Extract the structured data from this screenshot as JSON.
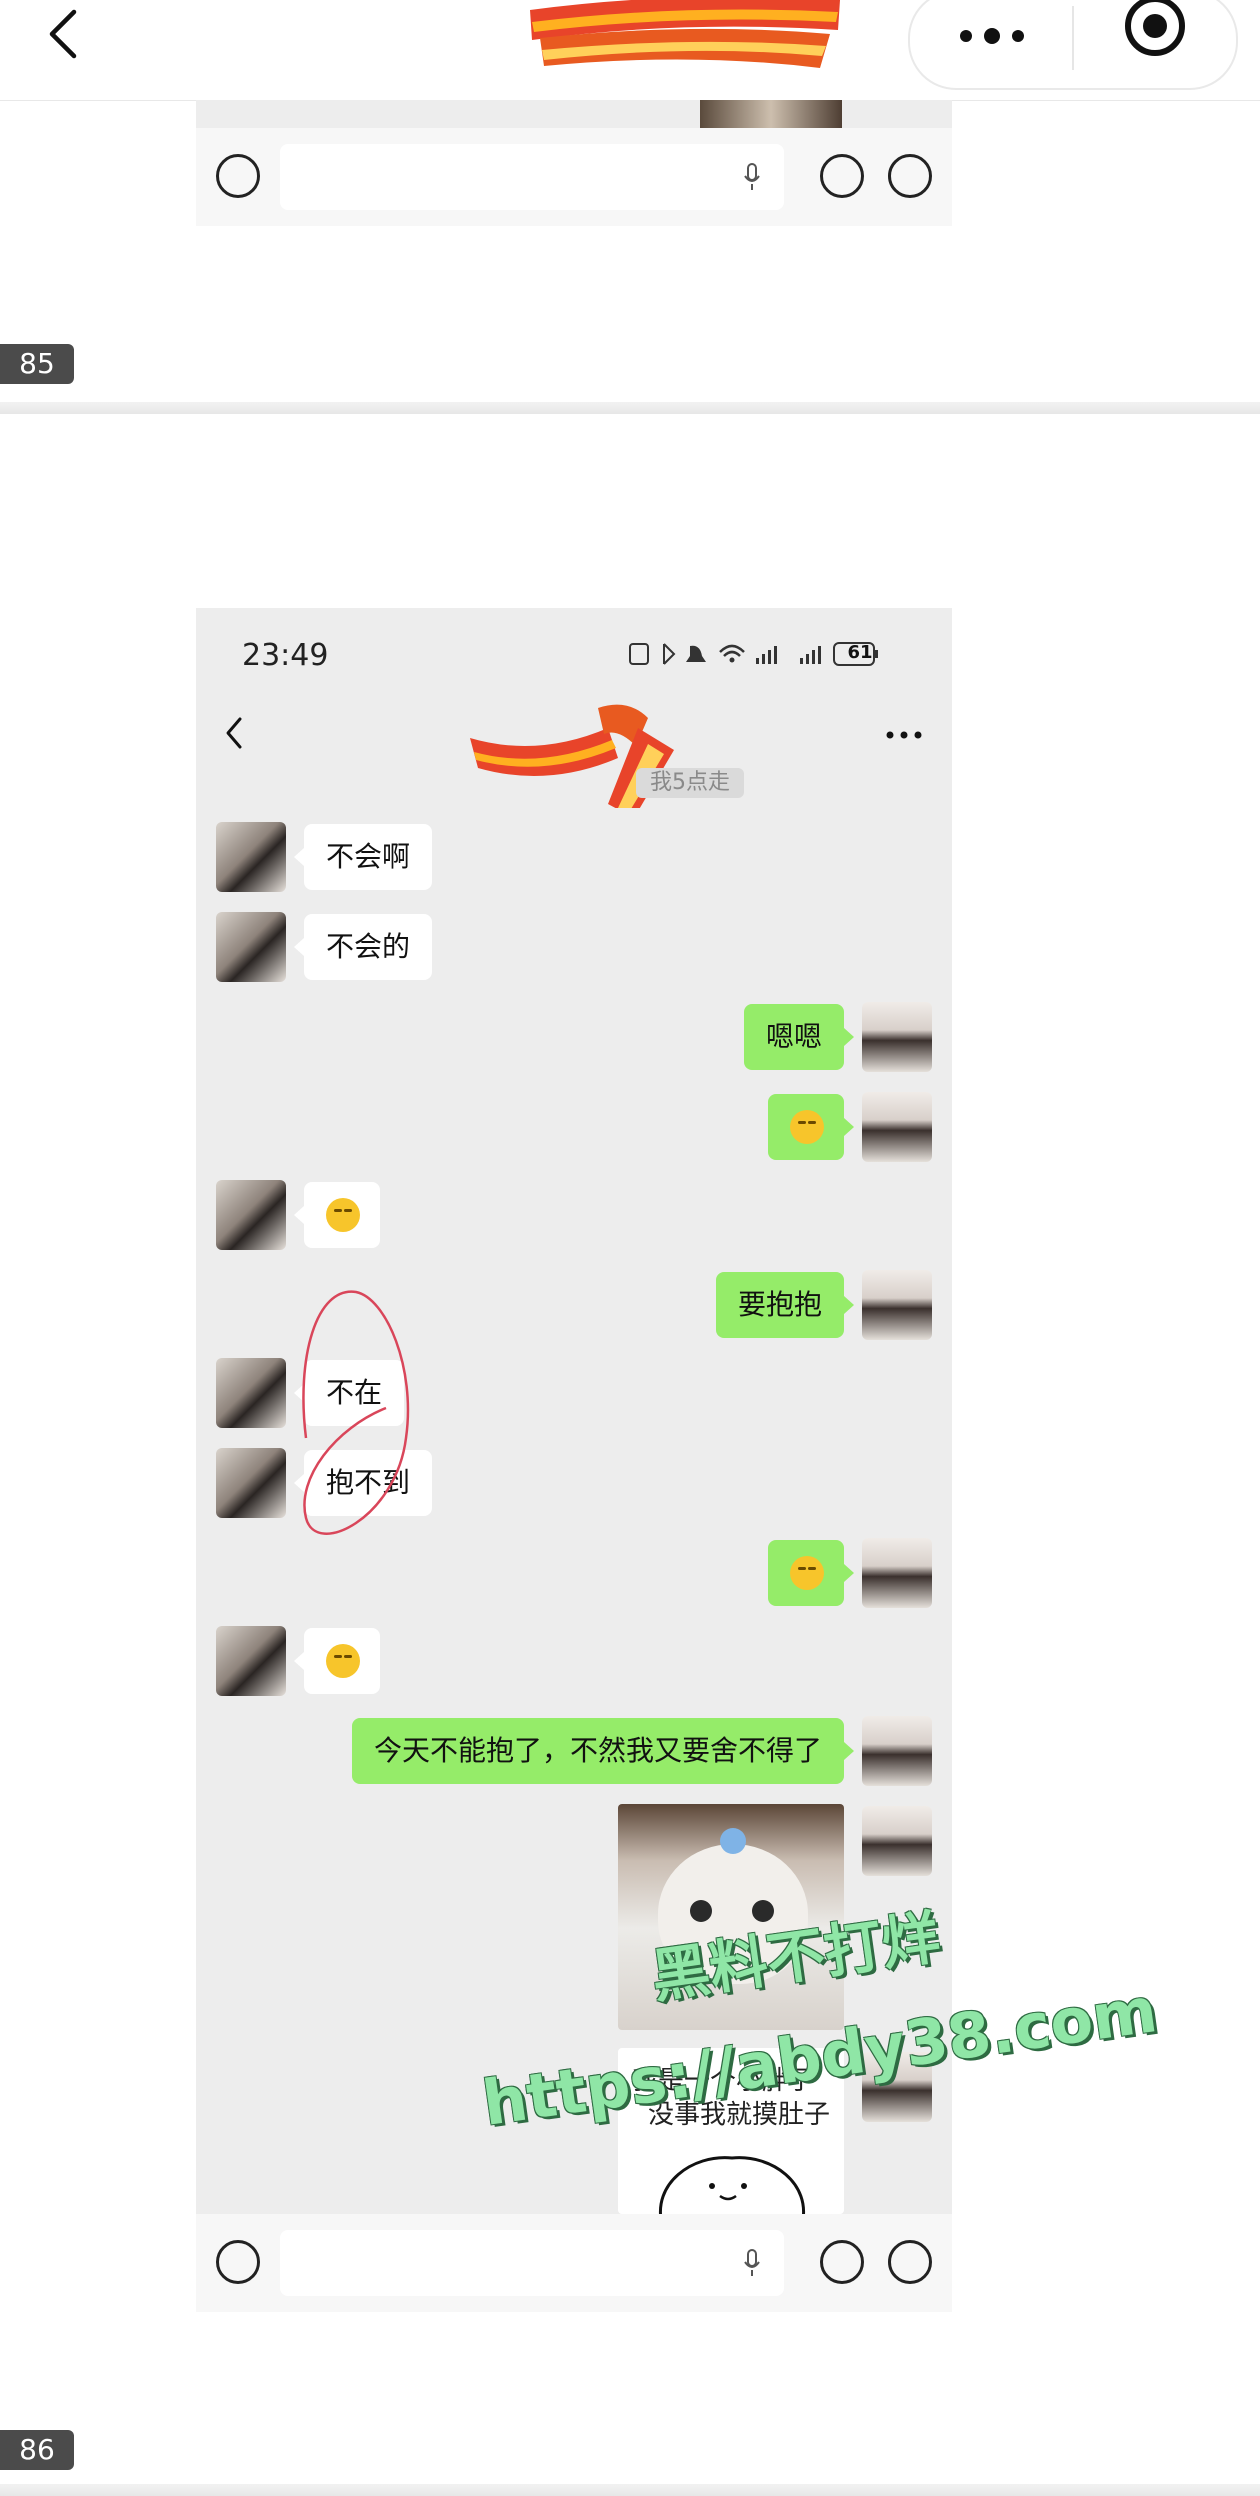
{
  "top_bar": {
    "back_icon": "chevron-left-icon",
    "more_icon": "three-dots-icon",
    "target_icon": "record-target-icon"
  },
  "pages": [
    {
      "page_number": "85"
    },
    {
      "page_number": "86"
    }
  ],
  "chat": {
    "status_bar": {
      "time": "23:49",
      "battery": "61"
    },
    "system_tip": "我5点走",
    "messages": [
      {
        "side": "left",
        "type": "text",
        "text": "不会啊"
      },
      {
        "side": "left",
        "type": "text",
        "text": "不会的"
      },
      {
        "side": "right",
        "type": "text",
        "text": "嗯嗯"
      },
      {
        "side": "right",
        "type": "emoji",
        "text": "😂"
      },
      {
        "side": "left",
        "type": "emoji",
        "text": "😂"
      },
      {
        "side": "right",
        "type": "text",
        "text": "要抱抱"
      },
      {
        "side": "left",
        "type": "text",
        "text": "不在"
      },
      {
        "side": "left",
        "type": "text",
        "text": "抱不到"
      },
      {
        "side": "right",
        "type": "emoji",
        "text": "😂"
      },
      {
        "side": "left",
        "type": "emoji",
        "text": "🙃"
      },
      {
        "side": "right",
        "type": "text",
        "text": "今天不能抱了，不然我又要舍不得了"
      },
      {
        "side": "right",
        "type": "sticker",
        "text": ""
      },
      {
        "side": "right",
        "type": "sticker",
        "text": "我是一个小胖子\n没事我就摸肚子"
      }
    ],
    "sticker_caption_line1": "我是一个小胖子",
    "sticker_caption_line2": "没事我就摸肚子"
  },
  "watermark": {
    "line1": "黑料不打烊",
    "line2": "https://abdy38.com"
  },
  "colors": {
    "panel_bg": "#ededed",
    "outgoing_bubble": "#95ec69",
    "incoming_bubble": "#ffffff",
    "page_badge": "#4b4b4b",
    "annotation_circle": "#d9465a"
  }
}
